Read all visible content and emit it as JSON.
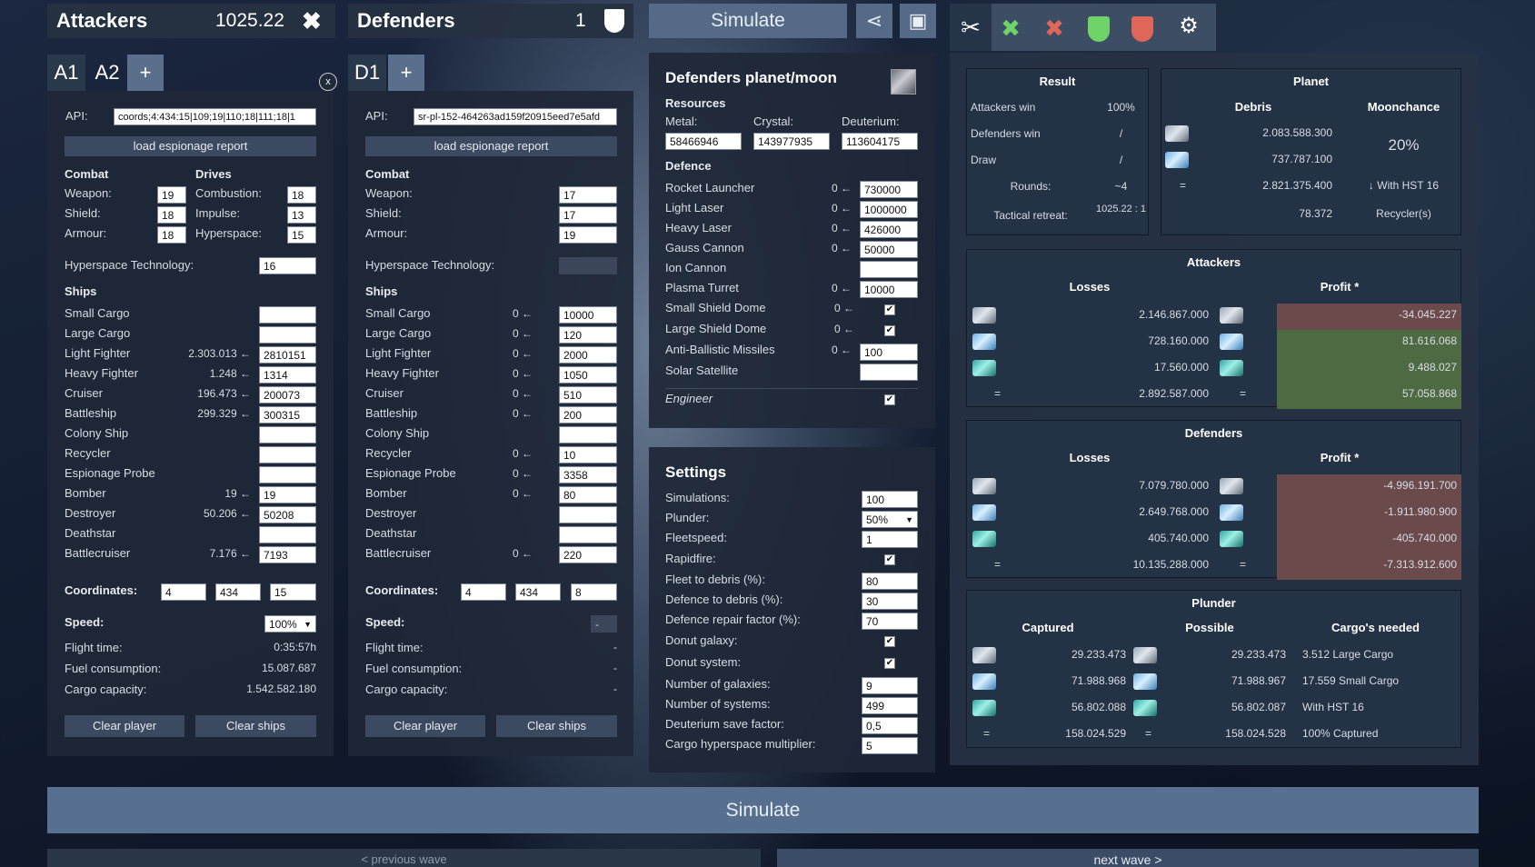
{
  "header": {
    "attackers_title": "Attackers",
    "attackers_value": "1025.22",
    "defenders_title": "Defenders",
    "defenders_value": "1",
    "simulate_label": "Simulate"
  },
  "attacker_tabs": [
    "A1",
    "A2",
    "+"
  ],
  "defender_tabs": [
    "D1",
    "+"
  ],
  "close_label": "x",
  "attacker": {
    "api_label": "API:",
    "api_value": "coords;4:434:15|109;19|110;18|111;18|1",
    "load_label": "load espionage report",
    "combat_title": "Combat",
    "drives_title": "Drives",
    "combat": [
      {
        "label": "Weapon:",
        "value": "19"
      },
      {
        "label": "Shield:",
        "value": "18"
      },
      {
        "label": "Armour:",
        "value": "18"
      }
    ],
    "drives": [
      {
        "label": "Combustion:",
        "value": "18"
      },
      {
        "label": "Impulse:",
        "value": "13"
      },
      {
        "label": "Hyperspace:",
        "value": "15"
      }
    ],
    "hyper_label": "Hyperspace Technology:",
    "hyper_value": "16",
    "ships_title": "Ships",
    "ships": [
      {
        "name": "Small Cargo",
        "lost": "",
        "value": ""
      },
      {
        "name": "Large Cargo",
        "lost": "",
        "value": ""
      },
      {
        "name": "Light Fighter",
        "lost": "2.303.013 ←",
        "value": "2810151"
      },
      {
        "name": "Heavy Fighter",
        "lost": "1.248 ←",
        "value": "1314"
      },
      {
        "name": "Cruiser",
        "lost": "196.473 ←",
        "value": "200073"
      },
      {
        "name": "Battleship",
        "lost": "299.329 ←",
        "value": "300315"
      },
      {
        "name": "Colony Ship",
        "lost": "",
        "value": ""
      },
      {
        "name": "Recycler",
        "lost": "",
        "value": ""
      },
      {
        "name": "Espionage Probe",
        "lost": "",
        "value": ""
      },
      {
        "name": "Bomber",
        "lost": "19 ←",
        "value": "19"
      },
      {
        "name": "Destroyer",
        "lost": "50.206 ←",
        "value": "50208"
      },
      {
        "name": "Deathstar",
        "lost": "",
        "value": ""
      },
      {
        "name": "Battlecruiser",
        "lost": "7.176 ←",
        "value": "7193"
      }
    ],
    "coords_label": "Coordinates:",
    "coords": [
      "4",
      "434",
      "15"
    ],
    "speed_label": "Speed:",
    "speed_value": "100%",
    "flight_label": "Flight time:",
    "flight_value": "0:35:57h",
    "fuel_label": "Fuel consumption:",
    "fuel_value": "15.087.687",
    "cargo_label": "Cargo capacity:",
    "cargo_value": "1.542.582.180",
    "clear_player": "Clear player",
    "clear_ships": "Clear ships"
  },
  "defender": {
    "api_label": "API:",
    "api_value": "sr-pl-152-464263ad159f20915eed7e5afd",
    "load_label": "load espionage report",
    "combat_title": "Combat",
    "combat": [
      {
        "label": "Weapon:",
        "value": "17"
      },
      {
        "label": "Shield:",
        "value": "17"
      },
      {
        "label": "Armour:",
        "value": "19"
      }
    ],
    "hyper_label": "Hyperspace Technology:",
    "hyper_value": "",
    "ships_title": "Ships",
    "ships": [
      {
        "name": "Small Cargo",
        "lost": "0 ←",
        "value": "10000"
      },
      {
        "name": "Large Cargo",
        "lost": "0 ←",
        "value": "120"
      },
      {
        "name": "Light Fighter",
        "lost": "0 ←",
        "value": "2000"
      },
      {
        "name": "Heavy Fighter",
        "lost": "0 ←",
        "value": "1050"
      },
      {
        "name": "Cruiser",
        "lost": "0 ←",
        "value": "510"
      },
      {
        "name": "Battleship",
        "lost": "0 ←",
        "value": "200"
      },
      {
        "name": "Colony Ship",
        "lost": "",
        "value": ""
      },
      {
        "name": "Recycler",
        "lost": "0 ←",
        "value": "10"
      },
      {
        "name": "Espionage Probe",
        "lost": "0 ←",
        "value": "3358"
      },
      {
        "name": "Bomber",
        "lost": "0 ←",
        "value": "80"
      },
      {
        "name": "Destroyer",
        "lost": "",
        "value": ""
      },
      {
        "name": "Deathstar",
        "lost": "",
        "value": ""
      },
      {
        "name": "Battlecruiser",
        "lost": "0 ←",
        "value": "220"
      }
    ],
    "coords_label": "Coordinates:",
    "coords": [
      "4",
      "434",
      "8"
    ],
    "speed_label": "Speed:",
    "speed_value": "-",
    "flight_label": "Flight time:",
    "flight_value": "-",
    "fuel_label": "Fuel consumption:",
    "fuel_value": "-",
    "cargo_label": "Cargo capacity:",
    "cargo_value": "-",
    "clear_player": "Clear player",
    "clear_ships": "Clear ships"
  },
  "planet": {
    "title": "Defenders planet/moon",
    "resources_title": "Resources",
    "metal_label": "Metal:",
    "metal": "58466946",
    "crystal_label": "Crystal:",
    "crystal": "143977935",
    "deut_label": "Deuterium:",
    "deut": "113604175",
    "defence_title": "Defence",
    "defence": [
      {
        "name": "Rocket Launcher",
        "lost": "0 ←",
        "value": "730000"
      },
      {
        "name": "Light Laser",
        "lost": "0 ←",
        "value": "1000000"
      },
      {
        "name": "Heavy Laser",
        "lost": "0 ←",
        "value": "426000"
      },
      {
        "name": "Gauss Cannon",
        "lost": "0 ←",
        "value": "50000"
      },
      {
        "name": "Ion Cannon",
        "lost": "",
        "value": ""
      },
      {
        "name": "Plasma Turret",
        "lost": "0 ←",
        "value": "10000"
      }
    ],
    "small_dome": "Small Shield Dome",
    "small_dome_lost": "0 ←",
    "large_dome": "Large Shield Dome",
    "large_dome_lost": "0 ←",
    "abm": "Anti-Ballistic Missiles",
    "abm_lost": "0 ←",
    "abm_value": "100",
    "solar": "Solar Satellite",
    "engineer": "Engineer"
  },
  "settings": {
    "title": "Settings",
    "rows": [
      {
        "label": "Simulations:",
        "value": "100"
      },
      {
        "label": "Plunder:",
        "value": "50%"
      },
      {
        "label": "Fleetspeed:",
        "value": "1"
      },
      {
        "label": "Rapidfire:",
        "value": "✔"
      },
      {
        "label": "Fleet to debris (%):",
        "value": "80"
      },
      {
        "label": "Defence to debris (%):",
        "value": "30"
      },
      {
        "label": "Defence repair factor (%):",
        "value": "70"
      },
      {
        "label": "Donut galaxy:",
        "value": "✔"
      },
      {
        "label": "Donut system:",
        "value": "✔"
      },
      {
        "label": "Number of galaxies:",
        "value": "9"
      },
      {
        "label": "Number of systems:",
        "value": "499"
      },
      {
        "label": "Deuterium save factor:",
        "value": "0,5"
      },
      {
        "label": "Cargo hyperspace multiplier:",
        "value": "5"
      }
    ]
  },
  "result": {
    "title": "Result",
    "rows": [
      {
        "label": "Attackers win",
        "value": "100%"
      },
      {
        "label": "Defenders win",
        "value": "/"
      },
      {
        "label": "Draw",
        "value": "/"
      },
      {
        "label": "Rounds:",
        "value": "~4"
      },
      {
        "label": "Tactical retreat:",
        "value": "1025.22 : 1"
      }
    ]
  },
  "planet_box": {
    "title": "Planet",
    "debris_title": "Debris",
    "moon_title": "Moonchance",
    "debris_metal": "2.083.588.300",
    "debris_crystal": "737.787.100",
    "debris_total": "2.821.375.400",
    "moonchance": "20%",
    "hst_label": "↓ With HST 16",
    "recyclers_count": "78.372",
    "recyclers_label": "Recycler(s)",
    "eq": "="
  },
  "attackers_box": {
    "title": "Attackers",
    "losses_title": "Losses",
    "profit_title": "Profit *",
    "rows": [
      {
        "loss": "2.146.867.000",
        "profit": "-34.045.227",
        "sign": "neg"
      },
      {
        "loss": "728.160.000",
        "profit": "81.616.068",
        "sign": "pos"
      },
      {
        "loss": "17.560.000",
        "profit": "9.488.027",
        "sign": "pos"
      }
    ],
    "total_loss": "2.892.587.000",
    "total_profit": "57.058.868",
    "eq": "="
  },
  "defenders_box": {
    "title": "Defenders",
    "losses_title": "Losses",
    "profit_title": "Profit *",
    "rows": [
      {
        "loss": "7.079.780.000",
        "profit": "-4.996.191.700"
      },
      {
        "loss": "2.649.768.000",
        "profit": "-1.911.980.900"
      },
      {
        "loss": "405.740.000",
        "profit": "-405.740.000"
      }
    ],
    "total_loss": "10.135.288.000",
    "total_profit": "-7.313.912.600",
    "eq": "="
  },
  "plunder_box": {
    "title": "Plunder",
    "captured_title": "Captured",
    "possible_title": "Possible",
    "cargo_title": "Cargo's needed",
    "rows": [
      {
        "captured": "29.233.473",
        "possible": "29.233.473",
        "cargo": "3.512  Large Cargo"
      },
      {
        "captured": "71.988.968",
        "possible": "71.988.967",
        "cargo": "17.559  Small Cargo"
      },
      {
        "captured": "56.802.088",
        "possible": "56.802.087",
        "cargo": "With HST 16"
      }
    ],
    "total_captured": "158.024.529",
    "total_possible": "158.024.528",
    "total_cargo": "100%  Captured",
    "eq": "="
  },
  "bottom": {
    "simulate": "Simulate",
    "prev": "< previous wave",
    "next": "next wave >"
  }
}
